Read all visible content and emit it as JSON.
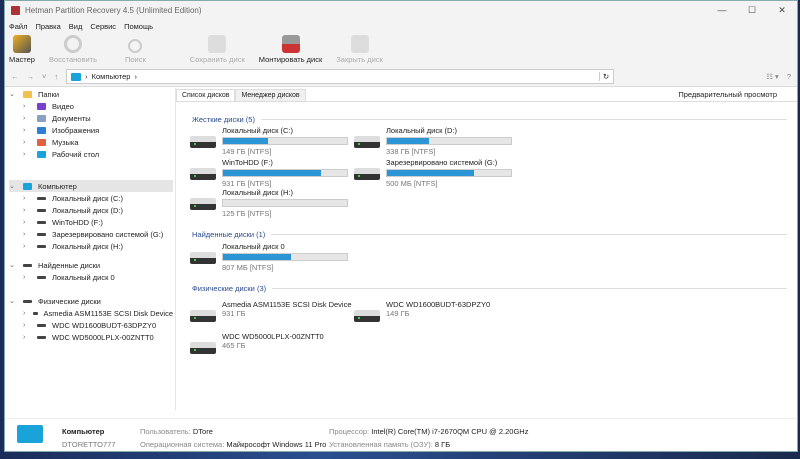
{
  "title": "Hetman Partition Recovery 4.5 (Unlimited Edition)",
  "menu": [
    "Файл",
    "Правка",
    "Вид",
    "Сервис",
    "Помощь"
  ],
  "toolbar": [
    {
      "label": "Мастер",
      "enabled": true
    },
    {
      "label": "Восстановить",
      "enabled": false
    },
    {
      "label": "Поиск",
      "enabled": false
    },
    {
      "label": "Сохранить диск",
      "enabled": false
    },
    {
      "label": "Монтировать диск",
      "enabled": true
    },
    {
      "label": "Закрыть диск",
      "enabled": false
    }
  ],
  "address": {
    "path": "Компьютер"
  },
  "tabs": {
    "disk_list": "Список дисков",
    "disk_manager": "Менеджер дисков",
    "preview": "Предварительный просмотр"
  },
  "tree": {
    "folders": {
      "label": "Папки",
      "items": [
        "Видео",
        "Документы",
        "Изображения",
        "Музыка",
        "Рабочий стол"
      ]
    },
    "computer": {
      "label": "Компьютер",
      "items": [
        "Локальный диск (C:)",
        "Локальный диск (D:)",
        "WinToHDD (F:)",
        "Зарезервировано системой (G:)",
        "Локальный диск (H:)"
      ]
    },
    "found": {
      "label": "Найденные диски",
      "items": [
        "Локальный диск 0"
      ]
    },
    "physical": {
      "label": "Физические диски",
      "items": [
        "Asmedia ASM1153E SCSI Disk Device",
        "WDC WD1600BUDT-63DPZY0",
        "WDC WD5000LPLX-00ZNTT0"
      ]
    }
  },
  "sections": {
    "hard": "Жесткие диски (5)",
    "found": "Найденные диски (1)",
    "physical": "Физические диски (3)"
  },
  "hard_disks": [
    {
      "name": "Локальный диск (C:)",
      "size": "149 ГБ [NTFS]",
      "used": 0.36
    },
    {
      "name": "Локальный диск (D:)",
      "size": "338 ГБ [NTFS]",
      "used": 0.34
    },
    {
      "name": "WinToHDD (F:)",
      "size": "931 ГБ [NTFS]",
      "used": 0.79
    },
    {
      "name": "Зарезервировано системой (G:)",
      "size": "500 МБ [NTFS]",
      "used": 0.7
    },
    {
      "name": "Локальный диск (H:)",
      "size": "125 ГБ [NTFS]",
      "used": 0
    }
  ],
  "found_disks": [
    {
      "name": "Локальный диск 0",
      "size": "807 МБ [NTFS]",
      "used": 0.55
    }
  ],
  "physical_disks": [
    {
      "name": "Asmedia ASM1153E SCSI Disk Device",
      "size": "931 ГБ"
    },
    {
      "name": "WDC WD1600BUDT-63DPZY0",
      "size": "149 ГБ"
    },
    {
      "name": "WDC WD5000LPLX-00ZNTT0",
      "size": "465 ГБ"
    }
  ],
  "status": {
    "name": "Компьютер",
    "host": "DTORETTO777",
    "user_label": "Пользователь:",
    "user": "DTore",
    "os_label": "Операционная система:",
    "os": "Майкрософт Windows 11 Pro",
    "cpu_label": "Процессор:",
    "cpu": "Intel(R) Core(TM) i7-2670QM CPU @ 2.20GHz",
    "ram_label": "Установленная память (ОЗУ):",
    "ram": "8 ГБ"
  },
  "colors": {
    "accent": "#2b95d6"
  }
}
